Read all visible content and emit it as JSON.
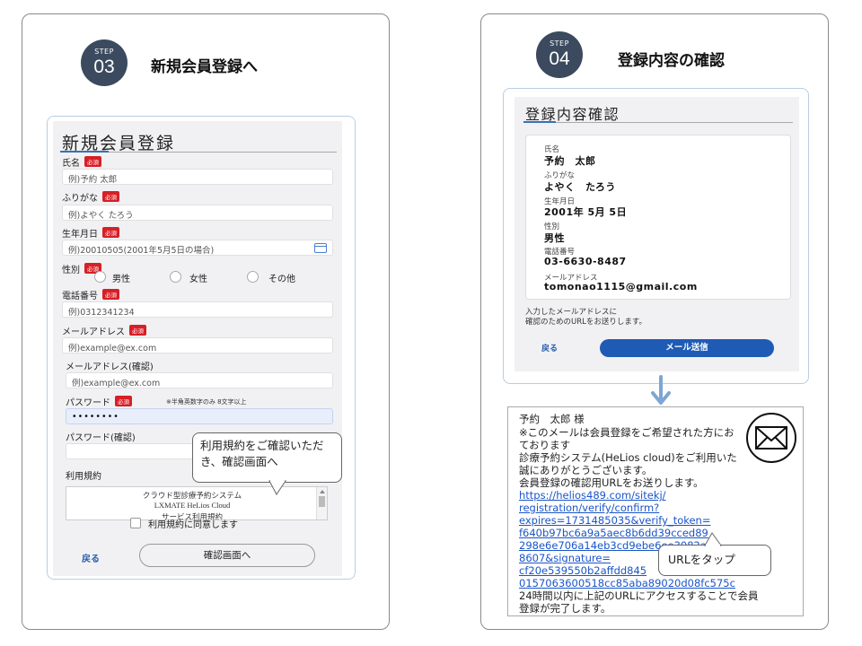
{
  "step3": {
    "label": "STEP",
    "number": "03",
    "title": "新規会員登録へ",
    "form": {
      "title": "新規会員登録",
      "required_badge": "必須",
      "name_label": "氏名",
      "name_placeholder": "例)予約 太郎",
      "kana_label": "ふりがな",
      "kana_placeholder": "例)よやく たろう",
      "birth_label": "生年月日",
      "birth_placeholder": "例)20010505(2001年5月5日の場合)",
      "gender_label": "性別",
      "gender_options": [
        "男性",
        "女性",
        "その他"
      ],
      "phone_label": "電話番号",
      "phone_placeholder": "例)0312341234",
      "email_label": "メールアドレス",
      "email_placeholder": "例)example@ex.com",
      "email_confirm_label": "メールアドレス(確認)",
      "email_confirm_placeholder": "例)example@ex.com",
      "password_label": "パスワード",
      "password_note": "※半角英数字のみ 8文字以上",
      "password_value": "••••••••",
      "password_confirm_label": "パスワード(確認)",
      "terms_label": "利用規約",
      "terms_lines": [
        "クラウド型診療予約システム",
        "LXMATE HeLios Cloud",
        "サービス利用規約"
      ],
      "agree_label": "利用規約に同意します",
      "back_label": "戻る",
      "confirm_button": "確認画面へ"
    },
    "callout": "利用規約をご確認いただき、確認画面へ"
  },
  "step4": {
    "label": "STEP",
    "number": "04",
    "title": "登録内容の確認",
    "confirm": {
      "title": "登録内容確認",
      "fields": [
        {
          "label": "氏名",
          "value": "予約　太郎"
        },
        {
          "label": "ふりがな",
          "value": "よやく　たろう"
        },
        {
          "label": "生年月日",
          "value": "2001年 5月 5日"
        },
        {
          "label": "性別",
          "value": "男性"
        },
        {
          "label": "電話番号",
          "value": "03-6630-8487"
        },
        {
          "label": "メールアドレス",
          "value": "tomonao1115@gmail.com"
        }
      ],
      "notice_line1": "入力したメールアドレスに",
      "notice_line2": "確認のためのURLをお送りします。",
      "back_label": "戻る",
      "send_button": "メール送信"
    },
    "email": {
      "lines": [
        "予約　太郎 様",
        "※このメールは会員登録をご希望された方にお",
        "ております",
        "診療予約システム(HeLios cloud)をご利用いた",
        "誠にありがとうございます。",
        "会員登録の確認用URLをお送りします。"
      ],
      "link_lines": [
        "https://helios489.com/sitekj/",
        "registration/verify/confirm?",
        "expires=1731485035&verify_token=",
        "f640b97bc6a9a5aec8b6dd39cced89",
        "298e6e706a14eb3cd9ebe6ee3082a",
        "8607&signature=",
        "cf20e539550b2affdd845",
        "0157063600518cc85aba89020d08fc575c"
      ],
      "footer_lines": [
        "24時間以内に上記のURLにアクセスすることで会員",
        "登録が完了します。"
      ]
    },
    "callout": "URLをタップ"
  },
  "colors": {
    "badge": "#3b4a5e",
    "required": "#d71f26",
    "primary_button": "#1f5bb5",
    "link": "#1a55c8",
    "arrow": "#7ea6d3"
  },
  "icons": [
    "calendar-icon",
    "arrow-down-icon",
    "mail-icon"
  ]
}
